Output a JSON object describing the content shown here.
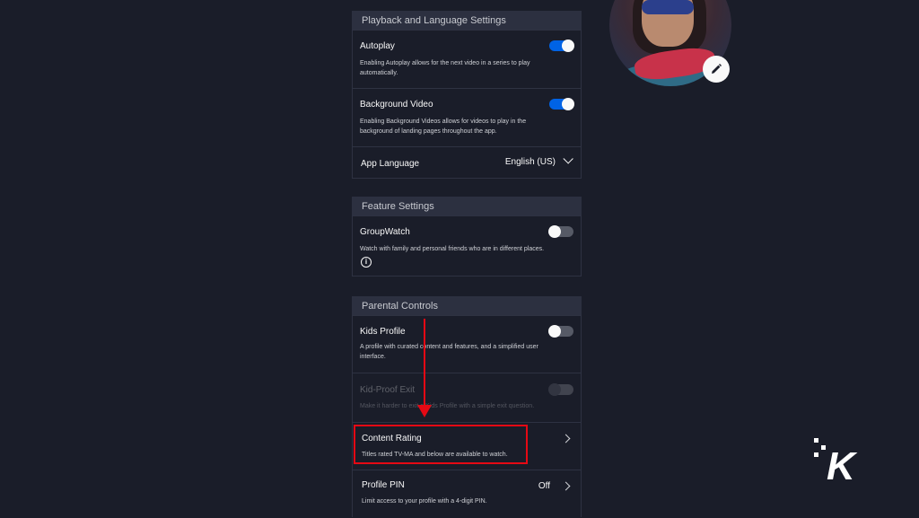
{
  "playback_section": {
    "header": "Playback and Language Settings",
    "autoplay": {
      "title": "Autoplay",
      "description": "Enabling Autoplay allows for the next video in a series to play automatically.",
      "enabled": true
    },
    "background_video": {
      "title": "Background Video",
      "description": "Enabling Background Videos allows for videos to play in the background of landing pages throughout the app.",
      "enabled": true
    },
    "app_language": {
      "title": "App Language",
      "value": "English (US)"
    }
  },
  "feature_section": {
    "header": "Feature Settings",
    "groupwatch": {
      "title": "GroupWatch",
      "description": "Watch with family and personal friends who are in different places.",
      "enabled": false
    }
  },
  "parental_section": {
    "header": "Parental Controls",
    "kids_profile": {
      "title": "Kids Profile",
      "description": "A profile with curated content and features, and a simplified user interface.",
      "enabled": false
    },
    "kid_proof_exit": {
      "title": "Kid-Proof Exit",
      "description": "Make it harder to exit a Kids Profile with a simple exit question.",
      "enabled": false,
      "disabled": true
    },
    "content_rating": {
      "title": "Content Rating",
      "description": "Titles rated TV-MA and below are available to watch."
    },
    "profile_pin": {
      "title": "Profile PIN",
      "description": "Limit access to your profile with a 4-digit PIN.",
      "value": "Off"
    }
  },
  "watermark": {
    "text": "K"
  },
  "colors": {
    "background": "#1a1d29",
    "section_header": "#2c3040",
    "toggle_on": "#0063e5",
    "highlight": "#e50914"
  }
}
